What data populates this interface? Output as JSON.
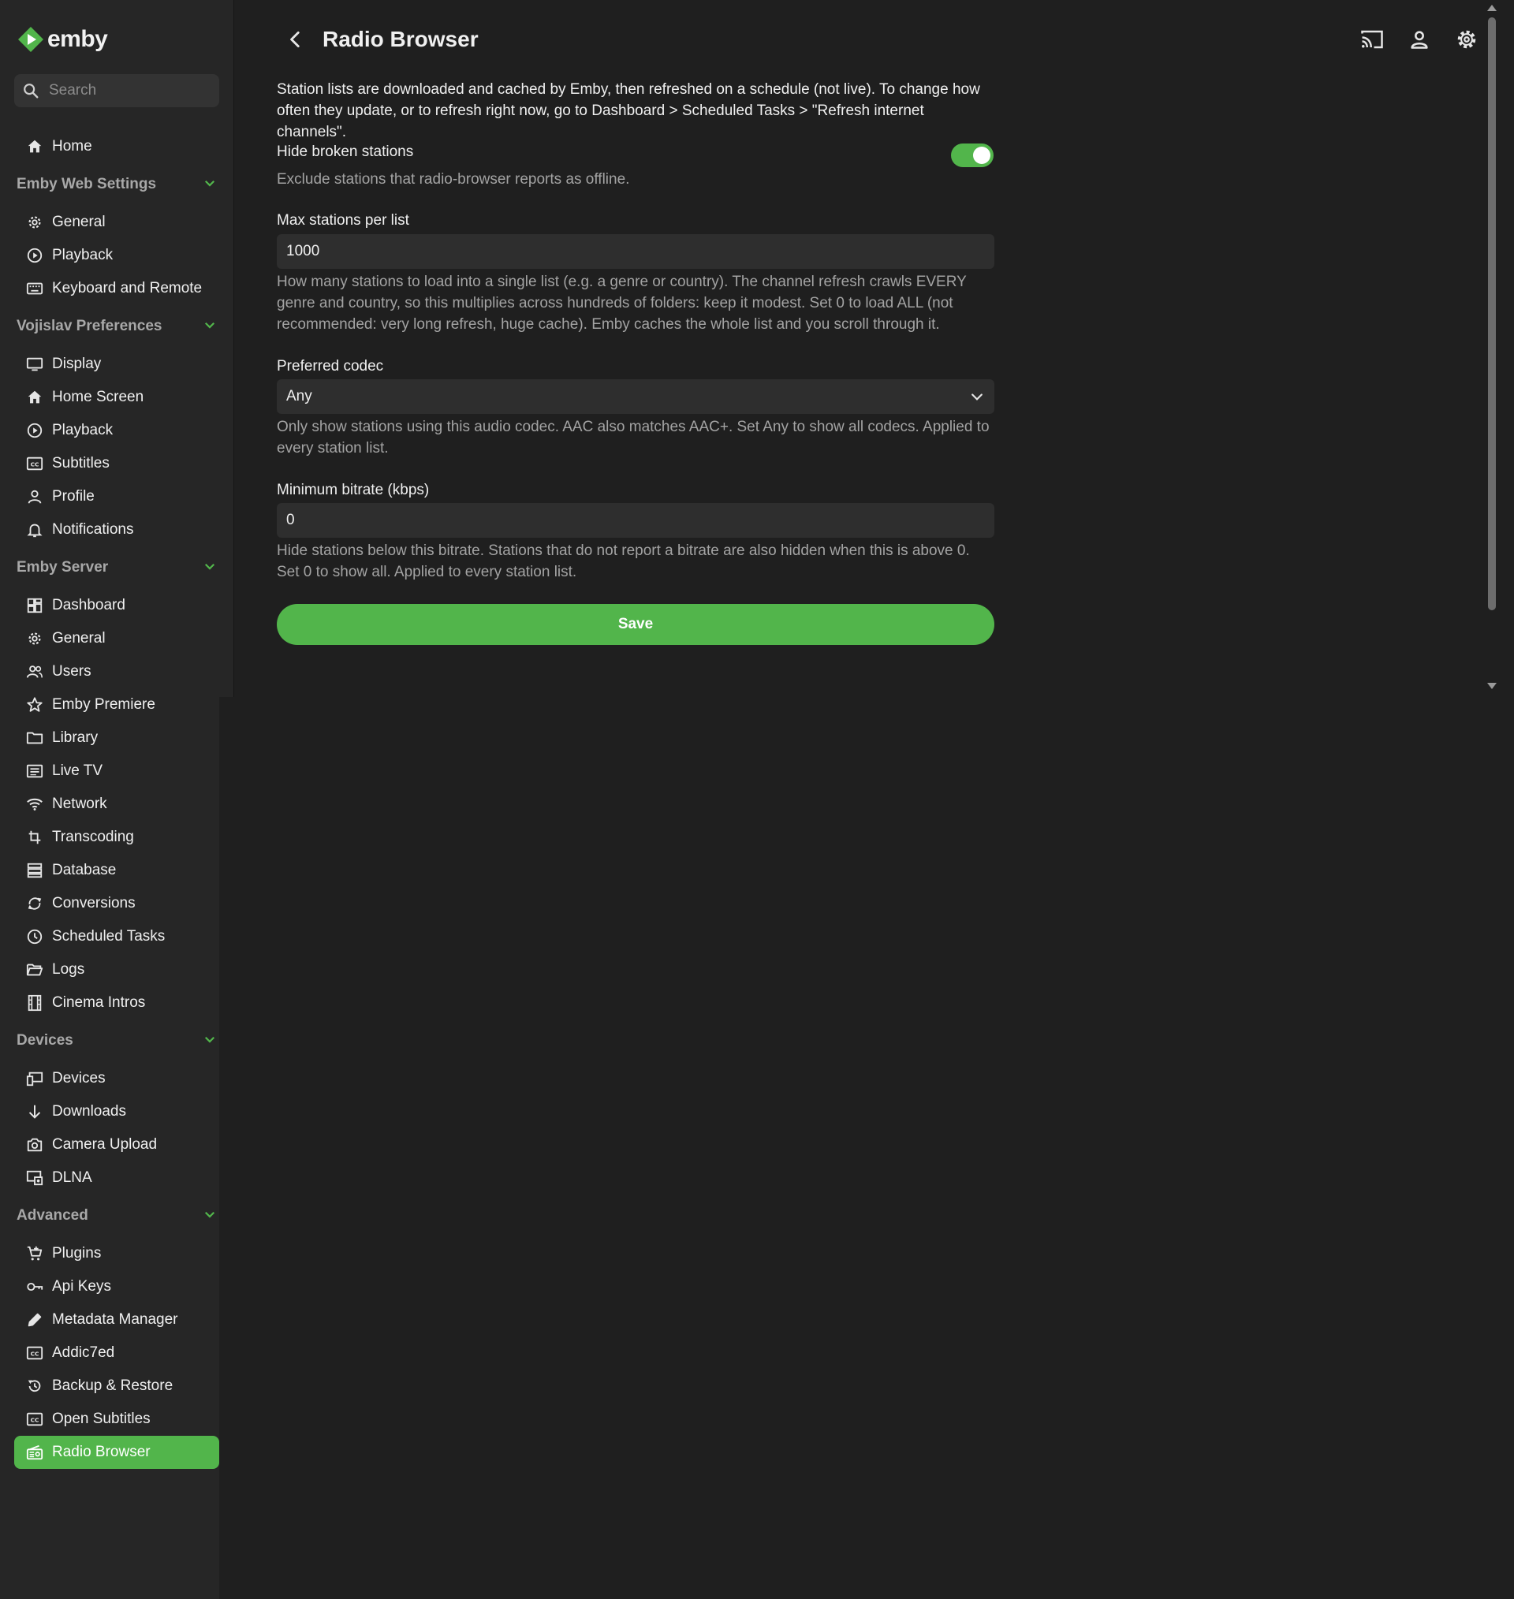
{
  "app": {
    "logo_text": "emby",
    "brand_color": "#52b54b"
  },
  "search": {
    "placeholder": "Search"
  },
  "nav": {
    "home": "Home",
    "sections": [
      {
        "title": "Emby Web Settings",
        "items": [
          "General",
          "Playback",
          "Keyboard and Remote"
        ]
      },
      {
        "title": "Vojislav Preferences",
        "items": [
          "Display",
          "Home Screen",
          "Playback",
          "Subtitles",
          "Profile",
          "Notifications"
        ]
      },
      {
        "title": "Emby Server",
        "items": [
          "Dashboard",
          "General",
          "Users",
          "Emby Premiere",
          "Library",
          "Live TV",
          "Network",
          "Transcoding",
          "Database",
          "Conversions",
          "Scheduled Tasks",
          "Logs",
          "Cinema Intros"
        ]
      },
      {
        "title": "Devices",
        "items": [
          "Devices",
          "Downloads",
          "Camera Upload",
          "DLNA"
        ]
      },
      {
        "title": "Advanced",
        "items": [
          "Plugins",
          "Api Keys",
          "Metadata Manager",
          "Addic7ed",
          "Backup & Restore",
          "Open Subtitles",
          "Radio Browser"
        ]
      }
    ],
    "active": "Radio Browser"
  },
  "page": {
    "title": "Radio Browser",
    "intro": "Station lists are downloaded and cached by Emby, then refreshed on a schedule (not live). To change how often they update, or to refresh right now, go to Dashboard > Scheduled Tasks > \"Refresh internet channels\".",
    "hide_broken": {
      "label": "Hide broken stations",
      "enabled": true,
      "description": "Exclude stations that radio-browser reports as offline."
    },
    "max_stations": {
      "label": "Max stations per list",
      "value": "1000",
      "description": "How many stations to load into a single list (e.g. a genre or country). The channel refresh crawls EVERY genre and country, so this multiplies across hundreds of folders: keep it modest. Set 0 to load ALL (not recommended: very long refresh, huge cache). Emby caches the whole list and you scroll through it."
    },
    "preferred_codec": {
      "label": "Preferred codec",
      "value": "Any",
      "description": "Only show stations using this audio codec. AAC also matches AAC+. Set Any to show all codecs. Applied to every station list."
    },
    "min_bitrate": {
      "label": "Minimum bitrate (kbps)",
      "value": "0",
      "description": "Hide stations below this bitrate. Stations that do not report a bitrate are also hidden when this is above 0. Set 0 to show all. Applied to every station list."
    },
    "save_label": "Save"
  }
}
